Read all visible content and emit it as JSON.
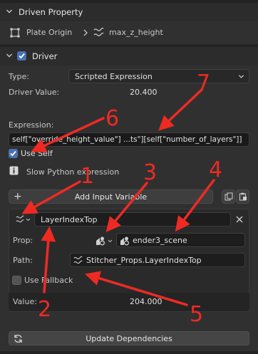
{
  "colors": {
    "accent": "#4772b3",
    "annotation": "#ee2a24",
    "panel": "#303030",
    "field": "#1d1d1d"
  },
  "driven_property": {
    "title": "Driven Property",
    "object_icon": "object-frame-icon",
    "object_name": "Plate Origin",
    "separator_icon": "chevron-right-icon",
    "property_icon": "curve-icon",
    "property_name": "max_z_height"
  },
  "driver": {
    "title": "Driver",
    "enabled": true,
    "type_label": "Type:",
    "type_value": "Scripted Expression",
    "value_label": "Driver Value:",
    "value": "20.400",
    "expression_label": "Expression:",
    "expression": "self[\"override_height_value\"] ...ts\"][self[\"number_of_layers\"]]",
    "use_self_label": "Use Self",
    "use_self": true,
    "warning_icon": "info-icon",
    "warning": "Slow Python expression",
    "add_variable_label": "Add Input Variable",
    "variable": {
      "name": "LayerIndexTop",
      "prop_label": "Prop:",
      "prop_value": "ender3_scene",
      "path_label": "Path:",
      "path_value": "Stitcher_Props.LayerIndexTop",
      "use_fallback_label": "Use Fallback",
      "use_fallback": false,
      "value_label": "Value:",
      "value": "204.000"
    },
    "update_label": "Update Dependencies"
  },
  "annotations": [
    "1",
    "2",
    "3",
    "4",
    "5",
    "6",
    "7"
  ]
}
